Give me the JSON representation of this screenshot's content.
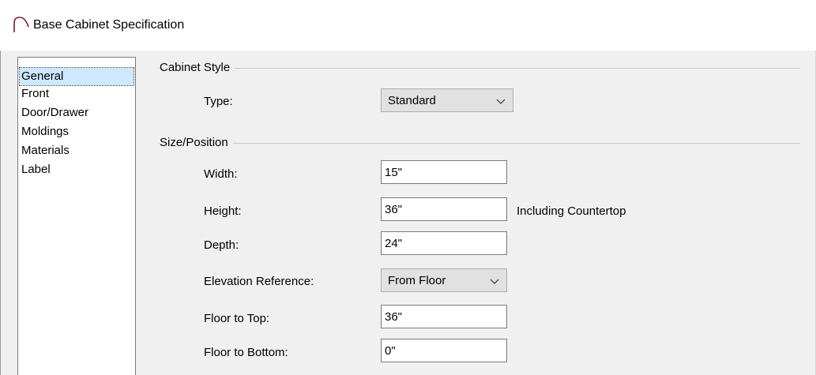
{
  "window": {
    "title": "Base Cabinet Specification",
    "icon": "arch-icon"
  },
  "sidebar": {
    "items": [
      {
        "label": "General",
        "selected": true
      },
      {
        "label": "Front",
        "selected": false
      },
      {
        "label": "Door/Drawer",
        "selected": false
      },
      {
        "label": "Moldings",
        "selected": false
      },
      {
        "label": "Materials",
        "selected": false
      },
      {
        "label": "Label",
        "selected": false
      }
    ]
  },
  "cabinet_style": {
    "heading": "Cabinet Style",
    "type_label": "Type:",
    "type_value": "Standard"
  },
  "size_position": {
    "heading": "Size/Position",
    "width_label": "Width:",
    "width_value": "15\"",
    "height_label": "Height:",
    "height_value": "36\"",
    "height_note": "Including Countertop",
    "depth_label": "Depth:",
    "depth_value": "24\"",
    "elevation_label": "Elevation Reference:",
    "elevation_value": "From Floor",
    "floor_to_top_label": "Floor to Top:",
    "floor_to_top_value": "36\"",
    "floor_to_bottom_label": "Floor to Bottom:",
    "floor_to_bottom_value": "0\""
  }
}
